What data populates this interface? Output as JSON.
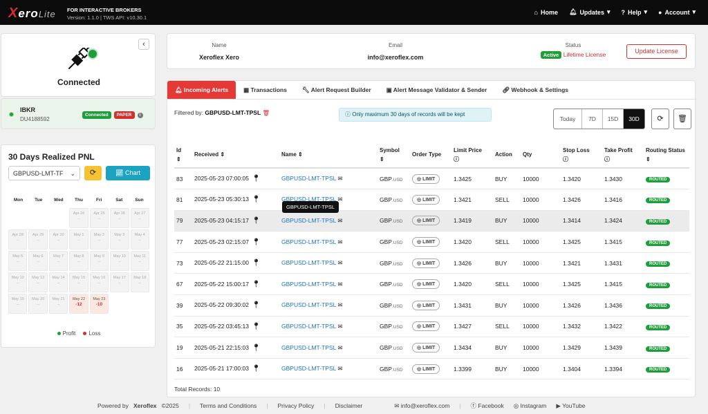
{
  "header": {
    "logo_x": "X",
    "logo_text": "ero",
    "logo_lite": "Lite",
    "brand_line": "FOR INTERACTIVE BROKERS",
    "version_line": "Version: 1.1.0 | TWS API: v10.30.1",
    "nav": {
      "home": "Home",
      "updates": "Updates",
      "help": "Help",
      "account": "Account"
    }
  },
  "connection": {
    "status": "Connected",
    "broker": "IBKR",
    "account_id": "DU4188592",
    "badge_connected": "Connected",
    "badge_paper": "PAPER"
  },
  "pnl": {
    "title": "30 Days Realized PNL",
    "symbol_select": "GBPUSD-LMT-TF",
    "chart_button": "Chart",
    "weekdays": [
      "Mon",
      "Tue",
      "Wed",
      "Thu",
      "Fri",
      "Sat",
      "Sun"
    ],
    "days": [
      {
        "d": "",
        "v": ""
      },
      {
        "d": "",
        "v": ""
      },
      {
        "d": "",
        "v": ""
      },
      {
        "d": "Apr 24",
        "v": "--"
      },
      {
        "d": "Apr 25",
        "v": "--"
      },
      {
        "d": "Apr 26",
        "v": "--"
      },
      {
        "d": "Apr 27",
        "v": "--"
      },
      {
        "d": "Apr 28",
        "v": "--"
      },
      {
        "d": "Apr 29",
        "v": "--"
      },
      {
        "d": "Apr 30",
        "v": "--"
      },
      {
        "d": "May 1",
        "v": "--"
      },
      {
        "d": "May 2",
        "v": "--"
      },
      {
        "d": "May 3",
        "v": "--"
      },
      {
        "d": "May 4",
        "v": "--"
      },
      {
        "d": "May 5",
        "v": "--"
      },
      {
        "d": "May 6",
        "v": "--"
      },
      {
        "d": "May 7",
        "v": "--"
      },
      {
        "d": "May 8",
        "v": "--"
      },
      {
        "d": "May 9",
        "v": "--"
      },
      {
        "d": "May 10",
        "v": "--"
      },
      {
        "d": "May 11",
        "v": "--"
      },
      {
        "d": "May 12",
        "v": "--"
      },
      {
        "d": "May 13",
        "v": "--"
      },
      {
        "d": "May 14",
        "v": "--"
      },
      {
        "d": "May 15",
        "v": "--"
      },
      {
        "d": "May 16",
        "v": "--"
      },
      {
        "d": "May 17",
        "v": "--"
      },
      {
        "d": "May 18",
        "v": "--"
      },
      {
        "d": "May 19",
        "v": "--"
      },
      {
        "d": "May 20",
        "v": "--"
      },
      {
        "d": "May 21",
        "v": "--"
      },
      {
        "d": "May 22",
        "v": "-12",
        "loss": true
      },
      {
        "d": "May 23",
        "v": "-10",
        "loss": true
      },
      {
        "d": "",
        "v": ""
      },
      {
        "d": "",
        "v": ""
      }
    ],
    "legend_profit": "Profit",
    "legend_loss": "Loss",
    "colors": {
      "profit": "#1e9e3a",
      "loss": "#d32f2f"
    }
  },
  "profile": {
    "name_label": "Name",
    "name": "Xeroflex Xero",
    "email_label": "Email",
    "email": "info@xeroflex.com",
    "status_label": "Status",
    "status_badge": "Active",
    "license": "Lifetime License",
    "update_button": "Update License"
  },
  "tabs": [
    "Incoming Alerts",
    "Transactions",
    "Alert Request Builder",
    "Alert Message Validator & Sender",
    "Webhook & Settings"
  ],
  "filter": {
    "label": "Filtered by:",
    "value": "GBPUSD-LMT-TPSL"
  },
  "notice": "Only maximum 30 days of records will be kept",
  "ranges": [
    "Today",
    "7D",
    "15D",
    "30D"
  ],
  "table": {
    "headers": [
      "Id",
      "Received",
      "Name",
      "Symbol",
      "Order Type",
      "Limit Price",
      "Action",
      "Qty",
      "Stop Loss",
      "Take Profit",
      "Routing Status"
    ],
    "rows": [
      {
        "id": "83",
        "received": "2025-05-23 07:00:05",
        "name": "GBPUSD-LMT-TPSL",
        "symbol": "GBP",
        "exch": ".USD",
        "type": "LIMIT",
        "limit": "1.3425",
        "action": "BUY",
        "qty": "10000",
        "sl": "1.3420",
        "tp": "1.3430",
        "status": "ROUTED"
      },
      {
        "id": "81",
        "received": "2025-05-23 05:30:13",
        "name": "GBPUSD-LMT-TPSL",
        "symbol": "GBP",
        "exch": ".USD",
        "type": "LIMIT",
        "limit": "1.3421",
        "action": "SELL",
        "qty": "10000",
        "sl": "1.3426",
        "tp": "1.3416",
        "status": "ROUTED"
      },
      {
        "id": "79",
        "received": "2025-05-23 04:15:17",
        "name": "GBPUSD-LMT-TPSL",
        "symbol": "GBP",
        "exch": ".USD",
        "type": "LIMIT",
        "limit": "1.3419",
        "action": "BUY",
        "qty": "10000",
        "sl": "1.3414",
        "tp": "1.3424",
        "status": "ROUTED"
      },
      {
        "id": "77",
        "received": "2025-05-23 02:15:07",
        "name": "GBPUSD-LMT-TPSL",
        "symbol": "GBP",
        "exch": ".USD",
        "type": "LIMIT",
        "limit": "1.3420",
        "action": "SELL",
        "qty": "10000",
        "sl": "1.3425",
        "tp": "1.3415",
        "status": "ROUTED"
      },
      {
        "id": "73",
        "received": "2025-05-22 21:15:00",
        "name": "GBPUSD-LMT-TPSL",
        "symbol": "GBP",
        "exch": ".USD",
        "type": "LIMIT",
        "limit": "1.3426",
        "action": "BUY",
        "qty": "10000",
        "sl": "1.3421",
        "tp": "1.3431",
        "status": "ROUTED"
      },
      {
        "id": "67",
        "received": "2025-05-22 15:00:17",
        "name": "GBPUSD-LMT-TPSL",
        "symbol": "GBP",
        "exch": ".USD",
        "type": "LIMIT",
        "limit": "1.3420",
        "action": "SELL",
        "qty": "10000",
        "sl": "1.3425",
        "tp": "1.3415",
        "status": "ROUTED"
      },
      {
        "id": "39",
        "received": "2025-05-22 09:30:02",
        "name": "GBPUSD-LMT-TPSL",
        "symbol": "GBP",
        "exch": ".USD",
        "type": "LIMIT",
        "limit": "1.3431",
        "action": "BUY",
        "qty": "10000",
        "sl": "1.3426",
        "tp": "1.3436",
        "status": "ROUTED"
      },
      {
        "id": "35",
        "received": "2025-05-22 03:45:13",
        "name": "GBPUSD-LMT-TPSL",
        "symbol": "GBP",
        "exch": ".USD",
        "type": "LIMIT",
        "limit": "1.3427",
        "action": "SELL",
        "qty": "10000",
        "sl": "1.3432",
        "tp": "1.3422",
        "status": "ROUTED"
      },
      {
        "id": "19",
        "received": "2025-05-21 22:15:03",
        "name": "GBPUSD-LMT-TPSL",
        "symbol": "GBP",
        "exch": ".USD",
        "type": "LIMIT",
        "limit": "1.3434",
        "action": "BUY",
        "qty": "10000",
        "sl": "1.3429",
        "tp": "1.3439",
        "status": "ROUTED"
      },
      {
        "id": "16",
        "received": "2025-05-21 17:00:03",
        "name": "GBPUSD-LMT-TPSL",
        "symbol": "GBP",
        "exch": ".USD",
        "type": "LIMIT",
        "limit": "1.3399",
        "action": "BUY",
        "qty": "10000",
        "sl": "1.3404",
        "tp": "1.3394",
        "status": "ROUTED"
      }
    ]
  },
  "tooltip": "GBPUSD-LMT-TPSL",
  "total_records": "Total Records: 10",
  "footer": {
    "powered": "Powered by",
    "brand": "Xeroflex",
    "copy": "©2025",
    "terms": "Terms and Conditions",
    "privacy": "Privacy Policy",
    "disclaimer": "Disclaimer",
    "email": "info@xeroflex.com",
    "facebook": "Facebook",
    "instagram": "Instagram",
    "youtube": "YouTube"
  }
}
